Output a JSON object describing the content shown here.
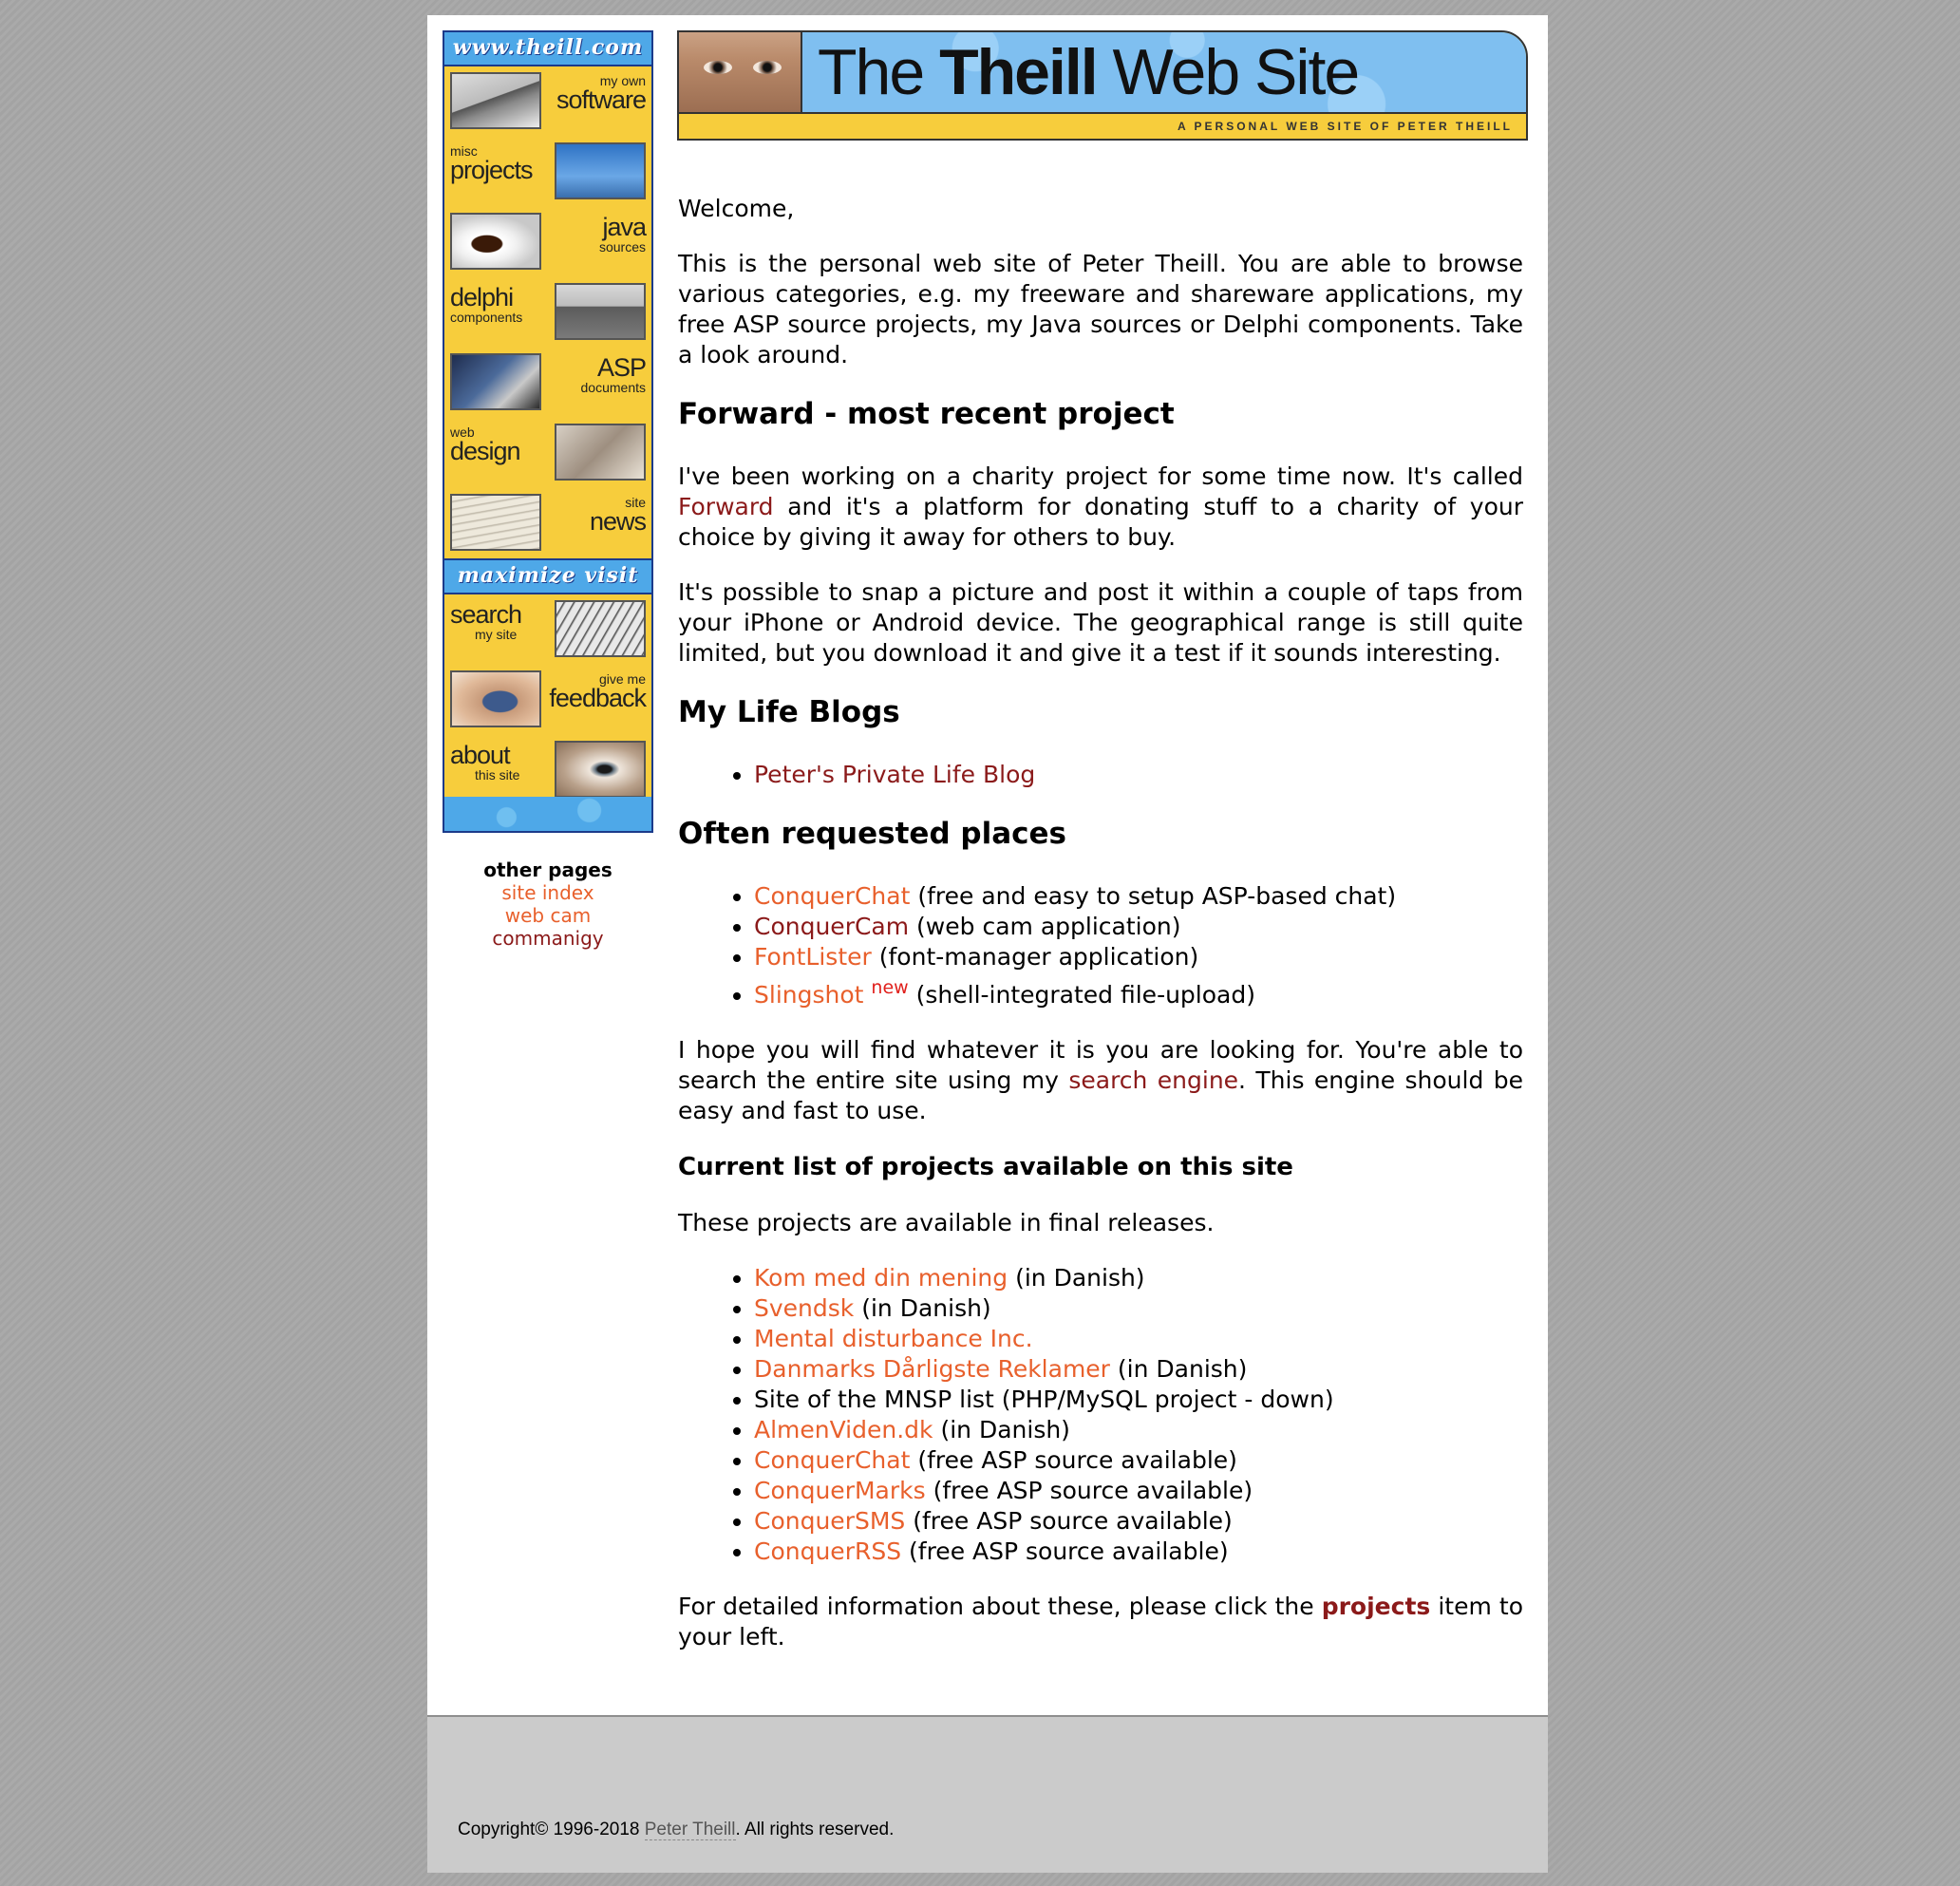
{
  "nav": {
    "top_header": "www.theill.com",
    "items": [
      {
        "small": "my own",
        "big": "software",
        "icon": "disk-icon"
      },
      {
        "small": "misc",
        "big": "projects",
        "icon": "windmill-icon"
      },
      {
        "big": "java",
        "small": "sources",
        "icon": "coffee-cup-icon"
      },
      {
        "big": "delphi",
        "small": "components",
        "icon": "ruins-icon"
      },
      {
        "big": "ASP",
        "small": "documents",
        "icon": "pen-icon"
      },
      {
        "small": "web",
        "big": "design",
        "icon": "sketch-icon"
      },
      {
        "small": "site",
        "big": "news",
        "icon": "newspaper-icon"
      }
    ],
    "mid_header": "maximize visit",
    "items2": [
      {
        "big": "search",
        "small": "my site",
        "icon": "roof-structure-icon"
      },
      {
        "small": "give me",
        "big": "feedback",
        "icon": "hand-phone-icon"
      },
      {
        "big": "about",
        "small": "this site",
        "icon": "eye-icon"
      }
    ]
  },
  "other_pages": {
    "title": "other pages",
    "links": [
      "site index",
      "web cam",
      "commanigy"
    ]
  },
  "banner": {
    "title_pre": "The ",
    "title_bold": "Theill",
    "title_post": " Web Site",
    "subtitle": "A PERSONAL WEB SITE OF PETER THEILL"
  },
  "content": {
    "welcome": "Welcome,",
    "intro": "This is the personal web site of Peter Theill. You are able to browse various categories, e.g. my freeware and shareware applications, my free ASP source projects, my Java sources or Delphi components. Take a look around.",
    "forward_heading": "Forward - most recent project",
    "forward_p1_a": "I've been working on a charity project for some time now. It's called ",
    "forward_link": "Forward",
    "forward_p1_b": " and it's a platform for donating stuff to a charity of your choice by giving it away for others to buy.",
    "forward_p2": "It's possible to snap a picture and post it within a couple of taps from your iPhone or Android device. The geographical range is still quite limited, but you download it and give it a test if it sounds interesting.",
    "blogs_heading": "My Life Blogs",
    "blogs": [
      {
        "link": "Peter's Private Life Blog"
      }
    ],
    "often_heading": "Often requested places",
    "often": [
      {
        "link": "ConquerChat",
        "desc": " (free and easy to setup ASP-based chat)",
        "style": "orange"
      },
      {
        "link": "ConquerCam",
        "desc": " (web cam application)",
        "style": "dark"
      },
      {
        "link": "FontLister",
        "desc": " (font-manager application)",
        "style": "orange"
      },
      {
        "link": "Slingshot",
        "sup": "new",
        "desc": " (shell-integrated file-upload)",
        "style": "orange"
      }
    ],
    "hope_a": "I hope you will find whatever it is you are looking for. You're able to search the entire site using my ",
    "hope_link": "search engine",
    "hope_b": ". This engine should be easy and fast to use.",
    "projects_heading": "Current list of projects available on this site",
    "projects_intro": "These projects are available in final releases.",
    "projects": [
      {
        "link": "Kom med din mening",
        "desc": " (in Danish)"
      },
      {
        "link": "Svendsk",
        "desc": " (in Danish)"
      },
      {
        "link": "Mental disturbance Inc.",
        "desc": ""
      },
      {
        "link": "Danmarks Dårligste Reklamer",
        "desc": " (in Danish)"
      },
      {
        "link": "",
        "desc": "Site of the MNSP list (PHP/MySQL project - down)"
      },
      {
        "link": "AlmenViden.dk",
        "desc": " (in Danish)"
      },
      {
        "link": "ConquerChat",
        "desc": " (free ASP source available)"
      },
      {
        "link": "ConquerMarks",
        "desc": " (free ASP source available)"
      },
      {
        "link": "ConquerSMS",
        "desc": " (free ASP source available)"
      },
      {
        "link": "ConquerRSS",
        "desc": " (free ASP source available)"
      }
    ],
    "detail_a": "For detailed information about these, please click the ",
    "detail_link": "projects",
    "detail_b": " item to your left."
  },
  "footer": {
    "copyright_a": "Copyright© 1996-2018 ",
    "copyright_link": "Peter Theill",
    "copyright_b": ". All rights reserved."
  },
  "colors": {
    "nav_yellow": "#f7cd3c",
    "nav_blue": "#4ea8e8",
    "link_dark": "#8b1a1a",
    "link_orange": "#e8602c",
    "new_red": "#e0201c",
    "footer_gray": "#cbcbcb"
  }
}
